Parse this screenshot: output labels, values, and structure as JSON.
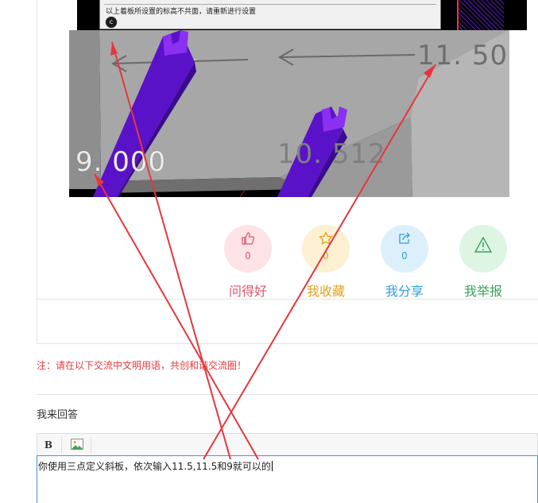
{
  "top_dialog": {
    "message": "以上着板所设置的标高不共面，请重新进行设置",
    "icon": "c"
  },
  "view3d": {
    "elevations": [
      "11. 500",
      "9. 000",
      "10. 512"
    ]
  },
  "actions": [
    {
      "label": "问得好",
      "count": "0",
      "icon": "thumbs-up-icon",
      "color": "#e0566b",
      "bg": "#fde3e6"
    },
    {
      "label": "我收藏",
      "count": "0",
      "icon": "star-icon",
      "color": "#e3a01b",
      "bg": "#fdf0d3"
    },
    {
      "label": "我分享",
      "count": "0",
      "icon": "share-icon",
      "color": "#2f9fd8",
      "bg": "#dcf0fb"
    },
    {
      "label": "我举报",
      "count": "0",
      "icon": "warning-icon",
      "color": "#3aa35b",
      "bg": "#dff5e3"
    }
  ],
  "notice": "注：请在以下交流中文明用语，共创和谐交流圈！",
  "reply": {
    "title": "我来回答",
    "toolbar": {
      "bold": "B",
      "image": "image-icon"
    },
    "content": "你使用三点定义斜板，依次输入11.5,11.5和9就可以的"
  },
  "annotation_color": "#e8353b"
}
